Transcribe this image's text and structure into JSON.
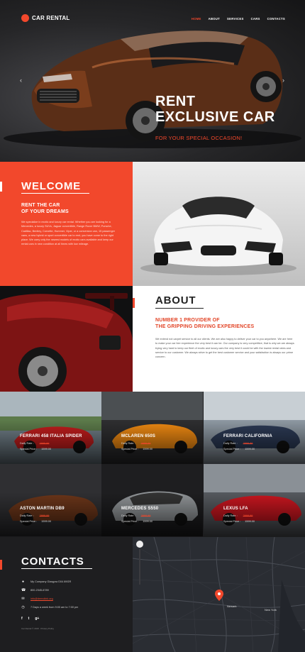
{
  "brand": {
    "name": "CAR RENTAL",
    "accent": "#f2482c"
  },
  "nav": {
    "items": [
      "HOME",
      "ABOUT",
      "SERVICES",
      "CARS",
      "CONTACTS"
    ],
    "active": "HOME"
  },
  "hero": {
    "title_line1": "RENT",
    "title_line2": "EXCLUSIVE CAR",
    "subtitle": "FOR YOUR SPECIAL OCCASION!",
    "prev_icon": "chevron-left",
    "next_icon": "chevron-right"
  },
  "welcome": {
    "heading": "WELCOME",
    "subheading_line1": "RENT THE CAR",
    "subheading_line2": "OF YOUR DREAMS",
    "body": "We specialize in exotic and luxury car rental. Whether you are looking for a Mercedes, a luxury SUVs, Jaguar convertible, Range Rover BMW, Porsche, Cadillac, Bentley, Corvette, Hummer, Viper, or a conversion van, 15 passenger vans, a new hybrid or sport convertible car to rent, you have come to the right place. We carry only the newest models of exotic cars available and keep our rental cars in new condition at all times with low mileage."
  },
  "about": {
    "heading": "ABOUT",
    "subheading_line1": "NUMBER 1 PROVIDER OF",
    "subheading_line2": "THE GRIPPING DRIVING EXPERIENCES",
    "body": "We extend not carpet service to all our clients. We are also happy to deliver your car to you anywhere. We are here to make your car hire experience the very best it can be. Our company is very competitive, that is why we are always trying very hard to keep our fleet of exotic and luxury cars the very best it could be with the lowest rental rates and service to our customer. We always strive to get the best customer service and your satisfaction is always our prime concern."
  },
  "cars": {
    "rate_label": "Daily Rate :",
    "special_label": "Special Price :",
    "items": [
      {
        "name": "FERRARI 458 ITALIA SPIDER",
        "old_price": "2999.99",
        "special_price": "1599.00"
      },
      {
        "name": "MCLAREN 650S",
        "old_price": "2999.99",
        "special_price": "1599.00"
      },
      {
        "name": "FERRARI CALIFORNIA",
        "old_price": "2999.99",
        "special_price": "1599.00"
      },
      {
        "name": "ASTON MARTIN DB9",
        "old_price": "2999.99",
        "special_price": "1599.00"
      },
      {
        "name": "MERCEDES S550",
        "old_price": "2999.99",
        "special_price": "1599.00"
      },
      {
        "name": "LEXUS LFA",
        "old_price": "2999.99",
        "special_price": "1599.00"
      }
    ]
  },
  "contacts": {
    "heading": "CONTACTS",
    "address": "My Company Glasgow D04 89GR",
    "phone": "800-2345-6789",
    "email": "info@demolink.org",
    "hours": "7 Days a week from 9:00 am to 7:00 pm",
    "social": [
      "f",
      "t",
      "g+"
    ],
    "copyright": "Car Rental © 2015 . Privacy Policy"
  },
  "map": {
    "city_label": "Newark",
    "city_label_2": "New York",
    "marker_color": "#f2482c"
  }
}
